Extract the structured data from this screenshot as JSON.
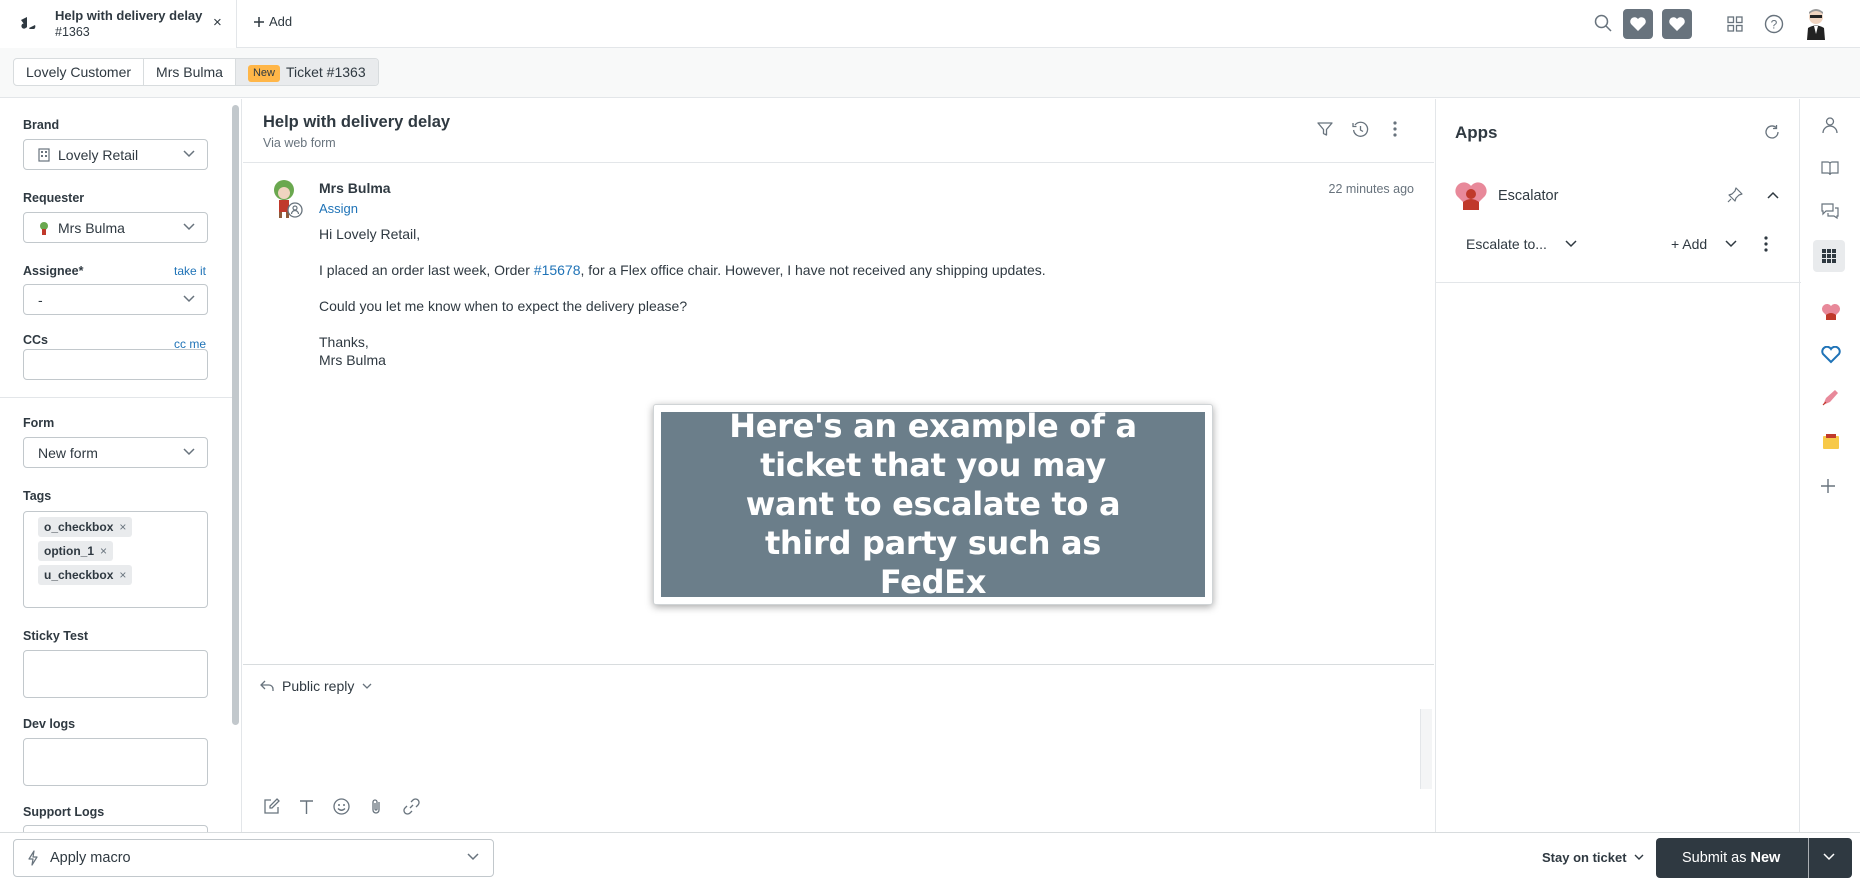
{
  "topbar": {
    "tab_title": "Help with delivery delay",
    "tab_subtitle": "#1363",
    "tab_close": "×",
    "add_label": "Add"
  },
  "breadcrumb": {
    "items": [
      "Lovely Customer",
      "Mrs Bulma"
    ],
    "status_badge": "New",
    "ticket": "Ticket #1363"
  },
  "sidebar": {
    "brand_label": "Brand",
    "brand_value": "Lovely Retail",
    "requester_label": "Requester",
    "requester_value": "Mrs Bulma",
    "assignee_label": "Assignee*",
    "assignee_link": "take it",
    "assignee_value": "-",
    "ccs_label": "CCs",
    "ccs_link": "cc me",
    "form_label": "Form",
    "form_value": "New form",
    "tags_label": "Tags",
    "tags": [
      "o_checkbox",
      "option_1",
      "u_checkbox"
    ],
    "tag_remove": "×",
    "sticky_label": "Sticky Test",
    "devlogs_label": "Dev logs",
    "supportlogs_label": "Support Logs"
  },
  "ticket": {
    "title": "Help with delivery delay",
    "via": "Via web form",
    "sender": "Mrs Bulma",
    "assign_link": "Assign",
    "time": "22 minutes ago",
    "greeting": "Hi Lovely Retail,",
    "line1_pre": "I placed an order last week, Order ",
    "order_link": "#15678",
    "line1_post": ", for a Flex office chair. However, I have not received any shipping updates.",
    "line2": "Could you let me know when to expect the delivery please?",
    "signoff": "Thanks,",
    "signature": "Mrs Bulma",
    "overlay_text": "Here's an example of a ticket that you may want to escalate to a third party such as FedEx",
    "reply_type": "Public reply"
  },
  "apps": {
    "title": "Apps",
    "app_name": "Escalator",
    "escalate_label": "Escalate to...",
    "add_label": "+ Add"
  },
  "footer": {
    "macro_label": "Apply macro",
    "stay_label": "Stay on ticket",
    "submit_prefix": "Submit as ",
    "submit_status": "New"
  },
  "colors": {
    "accent": "#1f73b7",
    "primary_button": "#2f3941",
    "new_badge": "#ffb648",
    "overlay": "#6b7e8a"
  },
  "icons": [
    "zendesk-logo-icon",
    "plus-icon",
    "search-icon",
    "heart-app-icon",
    "products-grid-icon",
    "help-icon",
    "user-avatar",
    "filter-icon",
    "history-icon",
    "more-icon",
    "pin-icon",
    "chevron-up-icon",
    "refresh-icon",
    "person-icon",
    "book-icon",
    "chat-icon",
    "apps-grid-icon",
    "escalator-icon",
    "pen-icon",
    "notepad-icon",
    "bolt-icon"
  ]
}
